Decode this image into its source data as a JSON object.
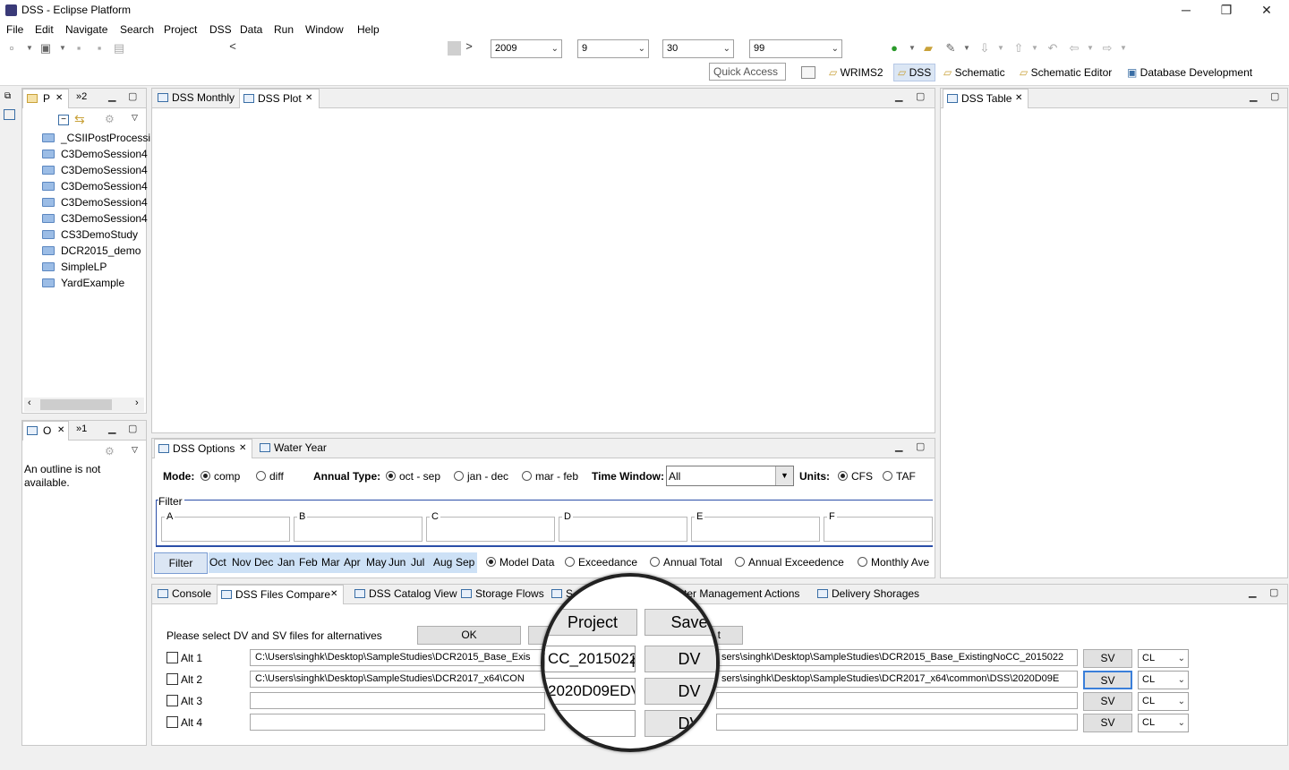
{
  "window": {
    "title": "DSS - Eclipse Platform",
    "minimize": "─",
    "restore": "❐",
    "close": "✕"
  },
  "menu": [
    "File",
    "Edit",
    "Navigate",
    "Search",
    "Project",
    "DSS",
    "Data",
    "Run",
    "Window",
    "Help"
  ],
  "toolbar": {
    "year": "2009",
    "month": "9",
    "day": "30",
    "hour": "99",
    "nav_prev": "<",
    "nav_next": ">",
    "quick_access": "Quick Access"
  },
  "perspectives": [
    "WRIMS2",
    "DSS",
    "Schematic",
    "Schematic Editor",
    "Database Development"
  ],
  "project_panel": {
    "tab": "P",
    "tab2": "»2",
    "items": [
      "_CSIIPostProcessi",
      "C3DemoSession4",
      "C3DemoSession4",
      "C3DemoSession4",
      "C3DemoSession4",
      "C3DemoSession4",
      "CS3DemoStudy",
      "DCR2015_demo",
      "SimpleLP",
      "YardExample"
    ]
  },
  "outline_panel": {
    "tab": "O",
    "tab2": "»1",
    "message": "An outline is not available."
  },
  "editor_tabs": [
    "DSS Monthly",
    "DSS Plot"
  ],
  "table_tab": "DSS Table",
  "dss_options": {
    "tabs": [
      "DSS Options",
      "Water Year"
    ],
    "mode_label": "Mode:",
    "mode_comp": "comp",
    "mode_diff": "diff",
    "annual_label": "Annual Type:",
    "annual_oct": "oct - sep",
    "annual_jan": "jan - dec",
    "annual_mar": "mar - feb",
    "time_window_label": "Time Window:",
    "time_window_value": "All",
    "units_label": "Units:",
    "units_cfs": "CFS",
    "units_taf": "TAF",
    "filter_label": "Filter",
    "filter_fields": [
      "A",
      "B",
      "C",
      "D",
      "E",
      "F"
    ],
    "filter_button": "Filter",
    "months": [
      "Oct",
      "Nov",
      "Dec",
      "Jan",
      "Feb",
      "Mar",
      "Apr",
      "May",
      "Jun",
      "Jul",
      "Aug",
      "Sep"
    ],
    "views": [
      "Model Data",
      "Exceedance",
      "Annual Total",
      "Annual Exceedence",
      "Monthly Ave"
    ]
  },
  "bottom_tabs": [
    "Console",
    "DSS Files Compare",
    "DSS Catalog View",
    "Storage Flows",
    "S",
    "ter Management Actions",
    "Delivery Shorages"
  ],
  "compare": {
    "prompt": "Please select DV and SV files for alternatives",
    "ok": "OK",
    "hidden_button": "t",
    "alts": [
      {
        "label": "Alt 1",
        "dv_path": "C:\\Users\\singhk\\Desktop\\SampleStudies\\DCR2015_Base_Exis",
        "sv_path": "sers\\singhk\\Desktop\\SampleStudies\\DCR2015_Base_ExistingNoCC_2015022",
        "sv": "SV",
        "cl": "CL"
      },
      {
        "label": "Alt 2",
        "dv_path": "C:\\Users\\singhk\\Desktop\\SampleStudies\\DCR2017_x64\\CON",
        "sv_path": "sers\\singhk\\Desktop\\SampleStudies\\DCR2017_x64\\common\\DSS\\2020D09E",
        "sv": "SV",
        "cl": "CL"
      },
      {
        "label": "Alt 3",
        "dv_path": "",
        "sv_path": "",
        "sv": "SV",
        "cl": "CL"
      },
      {
        "label": "Alt 4",
        "dv_path": "",
        "sv_path": "",
        "sv": "SV",
        "cl": "CL"
      }
    ]
  },
  "magnifier": {
    "project": "Project",
    "save": "Save",
    "field1": "CC_2015022",
    "field2": "2020D09EDV",
    "dv": "DV"
  },
  "colors": {
    "accent": "#3a6ea5",
    "highlight": "#cde1f6",
    "selected_button": "#3b7fd9"
  }
}
